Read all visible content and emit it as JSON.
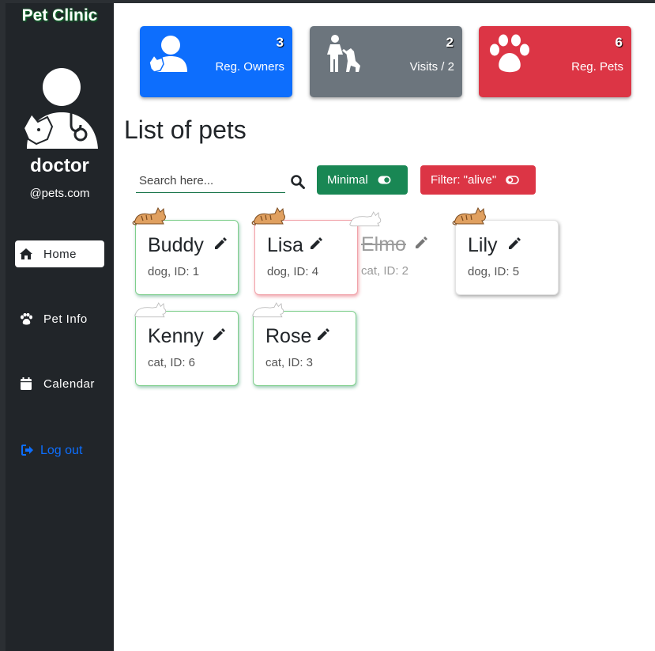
{
  "app": {
    "brand": "Pet Clinic"
  },
  "user": {
    "name": "doctor",
    "domain": "@pets.com"
  },
  "nav": {
    "items": [
      {
        "label": "Home",
        "icon": "home-icon",
        "active": true
      },
      {
        "label": "Pet Info",
        "icon": "paw-icon",
        "active": false
      },
      {
        "label": "Calendar",
        "icon": "calendar-icon",
        "active": false
      }
    ],
    "logout": "Log out"
  },
  "stats": [
    {
      "value": "3",
      "label": "Reg. Owners",
      "icon": "owner-with-pet-icon",
      "color": "#0d6efd"
    },
    {
      "value": "2",
      "label": "Visits / 2",
      "icon": "vet-with-dog-icon",
      "color": "#6c757d"
    },
    {
      "value": "6",
      "label": "Reg. Pets",
      "icon": "paw-icon",
      "color": "#dc3545"
    }
  ],
  "page": {
    "title": "List of pets"
  },
  "search": {
    "placeholder": "Search here..."
  },
  "buttons": {
    "minimal": "Minimal",
    "filter": "Filter: \"alive\""
  },
  "pets": [
    {
      "name": "Buddy",
      "species": "dog",
      "id": "1",
      "subtitle": "dog, ID: 1",
      "status": "alive",
      "border": "green"
    },
    {
      "name": "Lisa",
      "species": "dog",
      "id": "4",
      "subtitle": "dog, ID: 4",
      "status": "alive",
      "border": "red"
    },
    {
      "name": "Elmo",
      "species": "cat",
      "id": "2",
      "subtitle": "cat, ID: 2",
      "status": "dead",
      "border": "none"
    },
    {
      "name": "Lily",
      "species": "dog",
      "id": "5",
      "subtitle": "dog, ID: 5",
      "status": "alive",
      "border": "gray"
    },
    {
      "name": "Kenny",
      "species": "cat",
      "id": "6",
      "subtitle": "cat, ID: 6",
      "status": "alive",
      "border": "green"
    },
    {
      "name": "Rose",
      "species": "cat",
      "id": "3",
      "subtitle": "cat, ID: 3",
      "status": "alive",
      "border": "green"
    }
  ]
}
